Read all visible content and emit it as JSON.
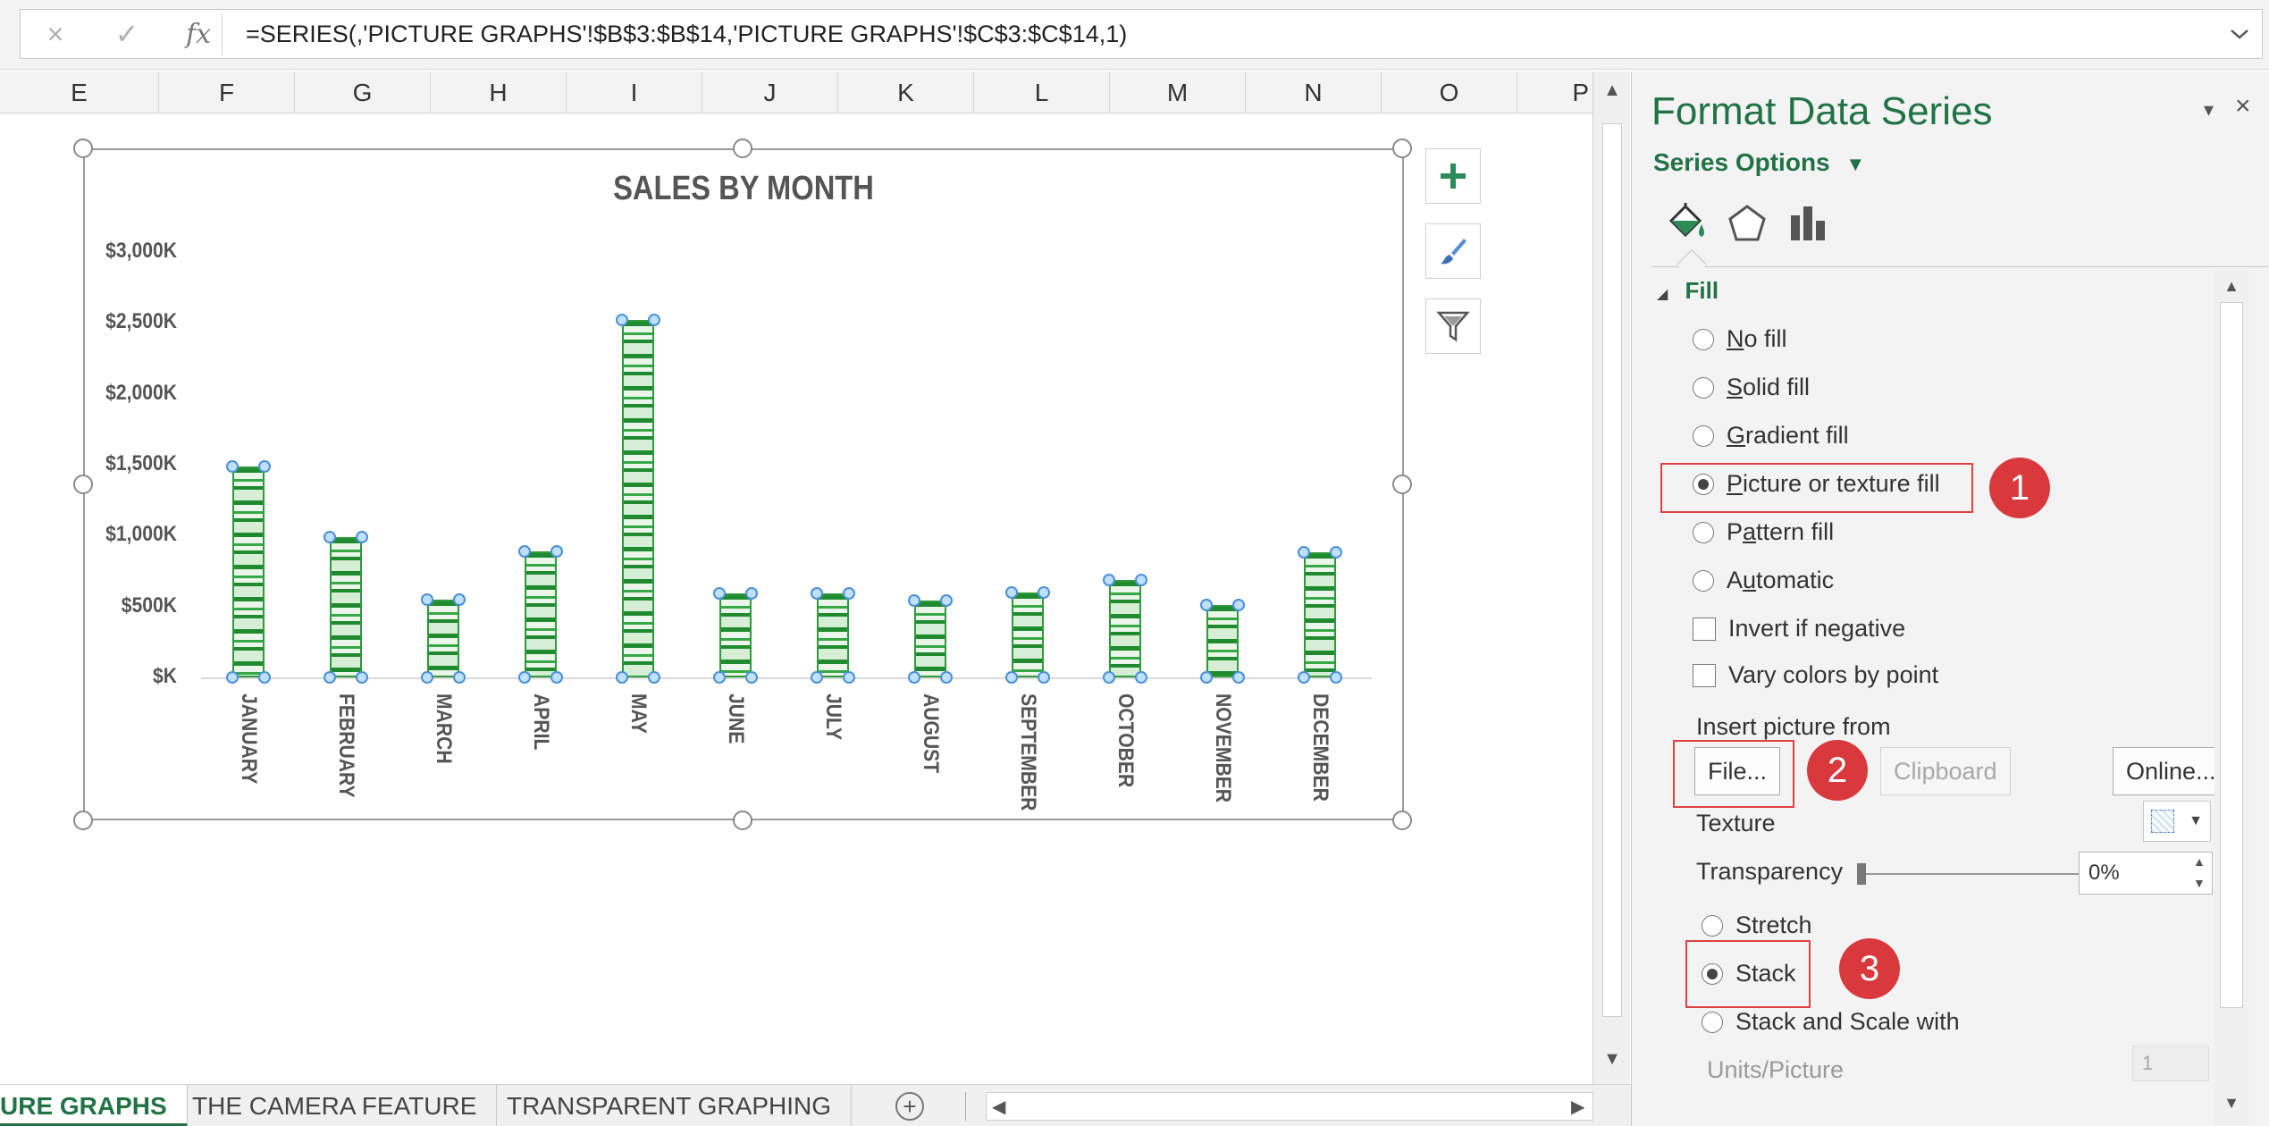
{
  "formula_bar": {
    "cancel_icon": "×",
    "enter_icon": "✓",
    "fx_label": "fx",
    "formula": "=SERIES(,'PICTURE GRAPHS'!$B$3:$B$14,'PICTURE GRAPHS'!$C$3:$C$14,1)"
  },
  "columns": [
    "E",
    "F",
    "G",
    "H",
    "I",
    "J",
    "K",
    "L",
    "M",
    "N",
    "O",
    "P"
  ],
  "chart_data": {
    "type": "bar",
    "title": "SALES BY MONTH",
    "categories": [
      "JANUARY",
      "FEBRUARY",
      "MARCH",
      "APRIL",
      "MAY",
      "JUNE",
      "JULY",
      "AUGUST",
      "SEPTEMBER",
      "OCTOBER",
      "NOVEMBER",
      "DECEMBER"
    ],
    "values": [
      1490,
      990,
      550,
      890,
      2520,
      590,
      590,
      540,
      600,
      690,
      510,
      880
    ],
    "ylim": [
      0,
      3000
    ],
    "yticks": [
      0,
      500,
      1000,
      1500,
      2000,
      2500,
      3000
    ],
    "ytick_labels": [
      "$K",
      "$500K",
      "$1,000K",
      "$1,500K",
      "$2,000K",
      "$2,500K",
      "$3,000K"
    ],
    "grid": false,
    "legend": "none",
    "bar_fill": "picture (stacked money icons)",
    "colors": {
      "bar": "#2e9a3b",
      "text": "#555555"
    }
  },
  "chart_buttons": [
    "plus-icon",
    "brush-icon",
    "filter-icon"
  ],
  "tabs": [
    {
      "label": "URE GRAPHS",
      "active": true
    },
    {
      "label": "THE CAMERA FEATURE",
      "active": false
    },
    {
      "label": "TRANSPARENT GRAPHING",
      "active": false
    }
  ],
  "pane": {
    "title": "Format Data Series",
    "series_options": "Series Options",
    "fill_header": "Fill",
    "fill_options": [
      {
        "label": "No fill",
        "key": "N",
        "selected": false
      },
      {
        "label": "Solid fill",
        "key": "S",
        "selected": false
      },
      {
        "label": "Gradient fill",
        "key": "G",
        "selected": false
      },
      {
        "label": "Picture or texture fill",
        "key": "P",
        "selected": true
      },
      {
        "label": "Pattern fill",
        "key": "a",
        "selected": false
      },
      {
        "label": "Automatic",
        "key": "u",
        "selected": false
      }
    ],
    "invert_if_negative": "Invert if negative",
    "vary_colors": "Vary colors by point",
    "insert_picture_from": "Insert picture from",
    "file_button": "File...",
    "clipboard_button": "Clipboard",
    "online_button": "Online...",
    "texture_label": "Texture",
    "transparency_label": "Transparency",
    "transparency_value": "0%",
    "stretch_label": "Stretch",
    "stack_label": "Stack",
    "stack_scale_label": "Stack and Scale with",
    "units_label": "Units/Picture",
    "units_value": "1",
    "callouts": [
      "1",
      "2",
      "3"
    ],
    "accent_color": "#217346",
    "callout_color": "#d9383c"
  }
}
